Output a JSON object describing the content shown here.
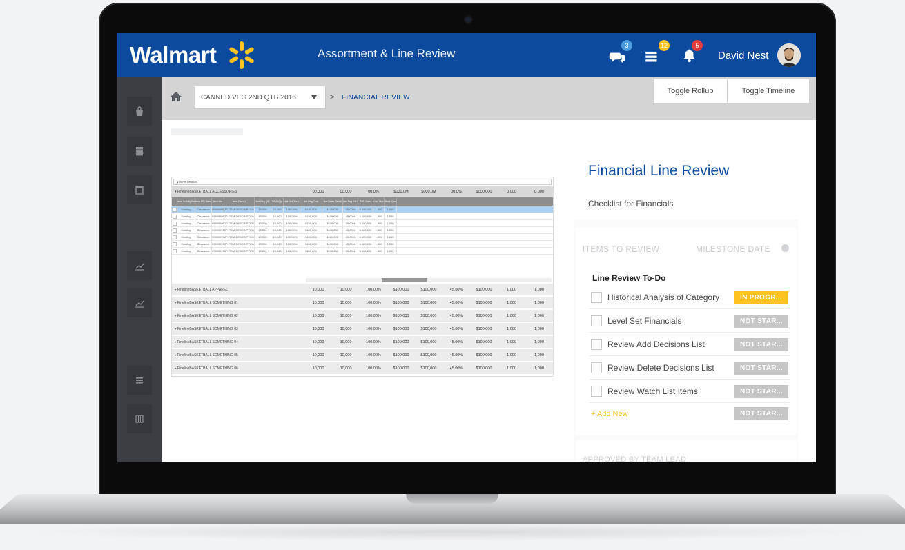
{
  "header": {
    "logo_text": "Walmart",
    "app_title": "Assortment & Line Review",
    "messages_count": "3",
    "tasks_count": "12",
    "alerts_count": "5",
    "user_name": "David Nest",
    "colors": {
      "header_bg": "#0c4a9e",
      "spark": "#ffc220",
      "messages_badge": "#4a9ee0",
      "tasks_badge": "#ffc220",
      "alerts_badge": "#e23c3c"
    }
  },
  "rail": {
    "icons": [
      "bag-icon",
      "server-icon",
      "calendar-icon",
      "trend-chart-icon",
      "trend-chart-icon",
      "list-icon",
      "table-icon"
    ]
  },
  "breadcrumb": {
    "category": "CANNED VEG 2ND QTR 2016",
    "separator": ">",
    "current": "FINANCIAL REVIEW"
  },
  "toolbar": {
    "toggle_rollup": "Toggle Rollup",
    "toggle_timeline": "Toggle Timeline"
  },
  "grid": {
    "toolbar_label": "▲ Items Detailed",
    "group_header": {
      "name": "▾ FinelineBASKETBALL ACCESSORIES",
      "values": [
        "00,000",
        "00,000",
        "00.0%",
        "$000.0M",
        "$000.0M",
        "00.0%",
        "$000,000",
        "0,000",
        "0,000"
      ]
    },
    "columns": [
      "Item Activity Status",
      "Item MD Status",
      "Item Nbr",
      "Item Desc 1",
      "Net Reg Qty",
      "POS Qty",
      "Unit Sell Thru %",
      "Net Reg Cost",
      "Net Sales Retail",
      "Net Reg IMU",
      "POS Sales",
      "Curr Store",
      "Store Count"
    ],
    "rows": [
      {
        "selected": true,
        "cells": [
          "Existing",
          "Clearance",
          "999999999",
          "2F1TEM DESCRIPTION",
          "10,000",
          "10,000",
          "100.00%",
          "$100,000",
          "$100,000",
          "45.00%",
          "$ 100,000",
          "1,000",
          "1,000"
        ]
      },
      {
        "selected": false,
        "cells": [
          "Existing",
          "Clearance",
          "999999999",
          "2F1TEM DESCRIPTION",
          "10,000",
          "10,000",
          "100.00%",
          "$100,000",
          "$100,000",
          "45.00%",
          "$ 100,000",
          "1,000",
          "1,000"
        ]
      },
      {
        "selected": false,
        "cells": [
          "Existing",
          "Clearance",
          "999999999",
          "2F1TEM DESCRIPTION",
          "10,000",
          "10,000",
          "100.00%",
          "$100,000",
          "$100,000",
          "45.00%",
          "$ 100,000",
          "1,000",
          "1,000"
        ]
      },
      {
        "selected": false,
        "cells": [
          "Existing",
          "Clearance",
          "999999999",
          "2F1TEM DESCRIPTION",
          "10,000",
          "10,000",
          "100.00%",
          "$100,000",
          "$100,000",
          "45.00%",
          "$ 100,000",
          "1,000",
          "1,000"
        ]
      },
      {
        "selected": false,
        "cells": [
          "Existing",
          "Clearance",
          "999999999",
          "2F1TEM DESCRIPTION",
          "10,000",
          "10,000",
          "100.00%",
          "$100,000",
          "$100,000",
          "45.00%",
          "$ 100,000",
          "1,000",
          "1,000"
        ]
      },
      {
        "selected": false,
        "cells": [
          "Existing",
          "Clearance",
          "999999999",
          "2F1TEM DESCRIPTION",
          "10,000",
          "10,000",
          "100.00%",
          "$100,000",
          "$100,000",
          "45.00%",
          "$ 100,000",
          "1,000",
          "1,000"
        ]
      },
      {
        "selected": false,
        "cells": [
          "Existing",
          "Clearance",
          "999999999",
          "2F1TEM DESCRIPTION",
          "10,000",
          "10,000",
          "100.00%",
          "$100,000",
          "$100,000",
          "45.00%",
          "$ 100,000",
          "1,000",
          "1,000"
        ]
      }
    ],
    "groups": [
      {
        "name": "▸ FinelineBASKETBALL APPAREL",
        "values": [
          "10,000",
          "10,000",
          "100.00%",
          "$100,000",
          "$100,000",
          "45.00%",
          "$100,000",
          "1,000",
          "1,000"
        ]
      },
      {
        "name": "▸ FinelineBASKETBALL SOMETHING 01",
        "values": [
          "10,000",
          "10,000",
          "100.00%",
          "$100,000",
          "$100,000",
          "45.00%",
          "$100,000",
          "1,000",
          "1,000"
        ]
      },
      {
        "name": "▸ FinelineBASKETBALL SOMETHING 02",
        "values": [
          "10,000",
          "10,000",
          "100.00%",
          "$100,000",
          "$100,000",
          "45.00%",
          "$100,000",
          "1,000",
          "1,000"
        ]
      },
      {
        "name": "▸ FinelineBASKETBALL SOMETHING 03",
        "values": [
          "10,000",
          "10,000",
          "100.00%",
          "$100,000",
          "$100,000",
          "45.00%",
          "$100,000",
          "1,000",
          "1,000"
        ]
      },
      {
        "name": "▸ FinelineBASKETBALL SOMETHING 04",
        "values": [
          "10,000",
          "10,000",
          "100.00%",
          "$100,000",
          "$100,000",
          "45.00%",
          "$100,000",
          "1,000",
          "1,000"
        ]
      },
      {
        "name": "▸ FinelineBASKETBALL SOMETHING 05",
        "values": [
          "10,000",
          "10,000",
          "100.00%",
          "$100,000",
          "$100,000",
          "45.00%",
          "$100,000",
          "1,000",
          "1,000"
        ]
      },
      {
        "name": "▸ FinelineBASKETBALL SOMETHING 06",
        "values": [
          "10,000",
          "10,000",
          "100.00%",
          "$100,000",
          "$100,000",
          "45.00%",
          "$100,000",
          "1,000",
          "1,000"
        ]
      }
    ]
  },
  "panel": {
    "title": "Financial Line Review",
    "subtitle": "Checklist for Financials",
    "col_items": "ITEMS TO REVIEW",
    "col_milestone": "MILESTONE DATE",
    "todo_title": "Line Review To-Do",
    "todos": [
      {
        "label": "Historical Analysis of Category",
        "status": "IN PROGR...",
        "kind": "prog"
      },
      {
        "label": "Level Set Financials",
        "status": "NOT STAR...",
        "kind": "ns"
      },
      {
        "label": "Review Add Decisions List",
        "status": "NOT STAR...",
        "kind": "ns"
      },
      {
        "label": "Review Delete Decisions List",
        "status": "NOT STAR...",
        "kind": "ns"
      },
      {
        "label": "Review Watch List Items",
        "status": "NOT STAR...",
        "kind": "ns"
      }
    ],
    "add_new": "+ Add New",
    "add_new_status": "NOT STAR...",
    "approval_label": "APPROVED BY TEAM LEAD"
  }
}
